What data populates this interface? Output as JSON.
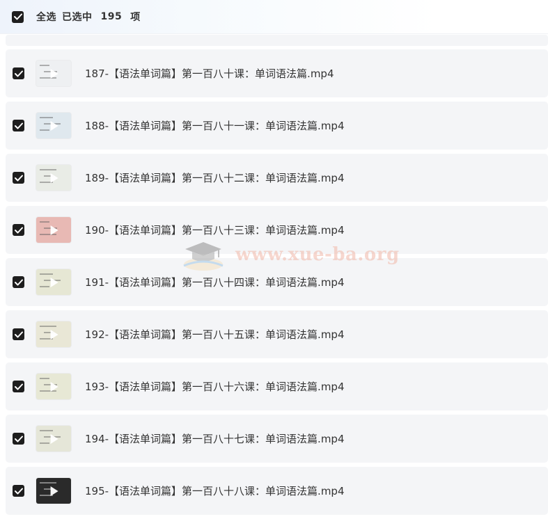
{
  "header": {
    "select_all_label": "全选",
    "selected_prefix": "已选中",
    "selected_count": "195",
    "selected_suffix": "项"
  },
  "watermark": {
    "text": "www.xue-ba.org"
  },
  "files": [
    {
      "name": "187-【语法单词篇】第一百八十课：单词语法篇.mp4",
      "checked": true,
      "thumb_bg": "#eef0f2"
    },
    {
      "name": "188-【语法单词篇】第一百八十一课：单词语法篇.mp4",
      "checked": true,
      "thumb_bg": "#dfe8ee"
    },
    {
      "name": "189-【语法单词篇】第一百八十二课：单词语法篇.mp4",
      "checked": true,
      "thumb_bg": "#e9ece6"
    },
    {
      "name": "190-【语法单词篇】第一百八十三课：单词语法篇.mp4",
      "checked": true,
      "thumb_bg": "#e8b9b4"
    },
    {
      "name": "191-【语法单词篇】第一百八十四课：单词语法篇.mp4",
      "checked": true,
      "thumb_bg": "#e6e7d4"
    },
    {
      "name": "192-【语法单词篇】第一百八十五课：单词语法篇.mp4",
      "checked": true,
      "thumb_bg": "#e9e7d6"
    },
    {
      "name": "193-【语法单词篇】第一百八十六课：单词语法篇.mp4",
      "checked": true,
      "thumb_bg": "#e7e8d5"
    },
    {
      "name": "194-【语法单词篇】第一百八十七课：单词语法篇.mp4",
      "checked": true,
      "thumb_bg": "#e5e6d8"
    },
    {
      "name": "195-【语法单词篇】第一百八十八课：单词语法篇.mp4",
      "checked": true,
      "thumb_bg": "#2a2a2a"
    }
  ]
}
